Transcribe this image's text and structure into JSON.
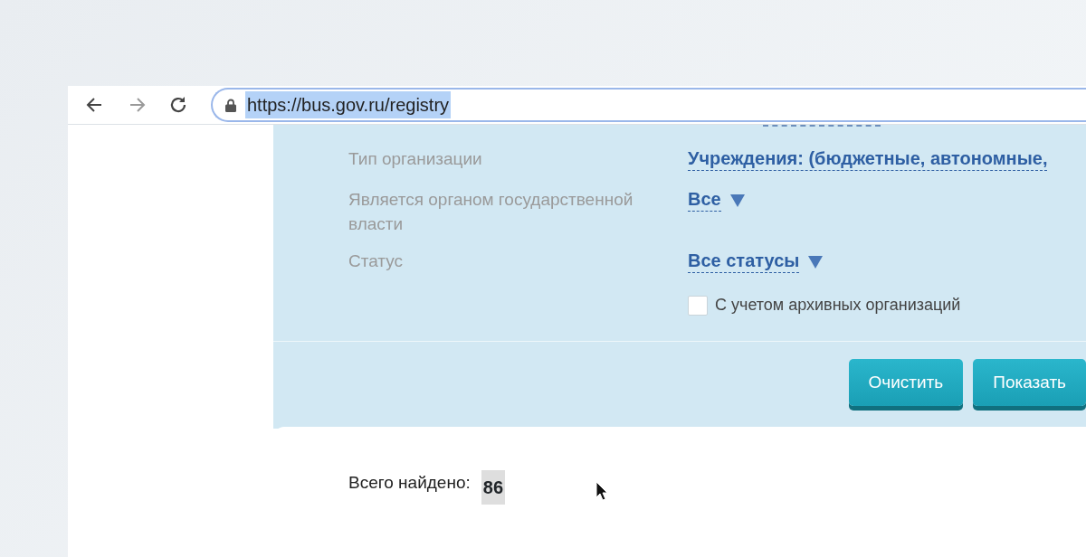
{
  "browser": {
    "nav_buttons": [
      {
        "kind": "back",
        "disabled": false
      },
      {
        "kind": "forward",
        "disabled": true
      },
      {
        "kind": "reload",
        "disabled": false
      }
    ],
    "address_bar": {
      "url": "https://bus.gov.ru/registry",
      "selected": true
    }
  },
  "filters": [
    {
      "label": "Тип организации",
      "value": "Учреждения: (бюджетные, автономные,",
      "dropdown": false
    },
    {
      "label": "Является органом государственной власти",
      "value": "Все",
      "dropdown": true
    },
    {
      "label": "Статус",
      "value": "Все статусы",
      "dropdown": true
    }
  ],
  "archive_checkbox": {
    "label": "С учетом архивных организаций",
    "checked": false
  },
  "buttons": [
    "Очистить",
    "Показать"
  ],
  "results": {
    "label": "Всего найдено:",
    "count": "86"
  }
}
